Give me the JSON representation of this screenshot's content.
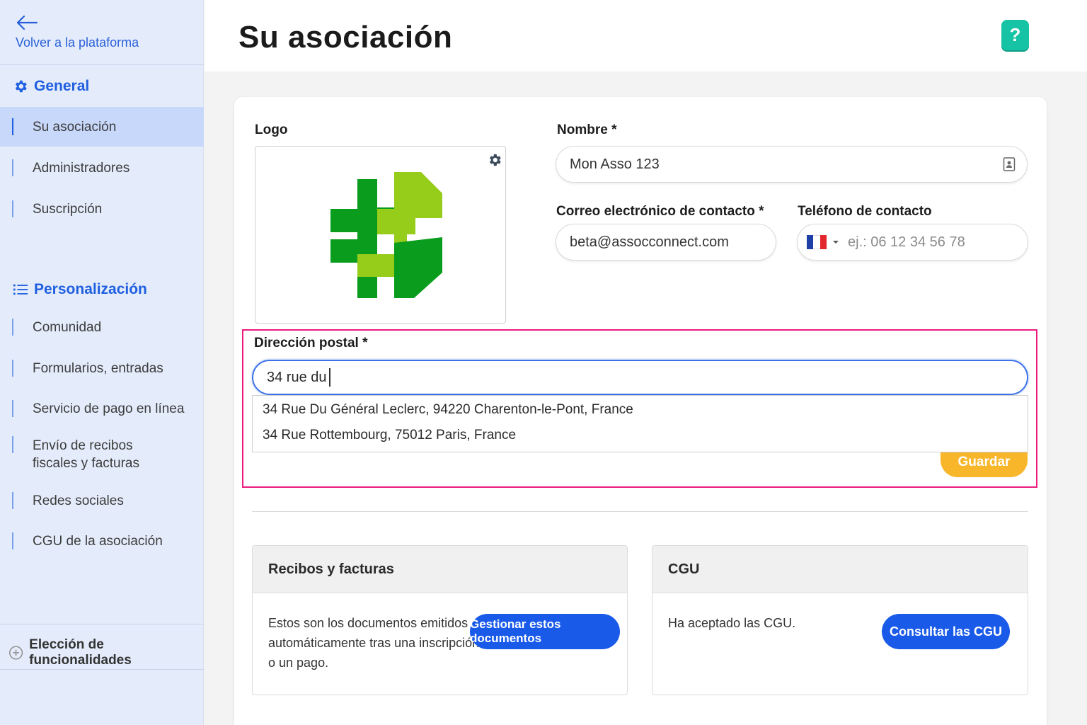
{
  "sidebar": {
    "back_label": "Volver a la plataforma",
    "sections": [
      {
        "title": "General",
        "icon": "gear-icon",
        "items": [
          {
            "label": "Su asociación",
            "active": true
          },
          {
            "label": "Administradores"
          },
          {
            "label": "Suscripción"
          }
        ]
      },
      {
        "title": "Personalización",
        "icon": "list-icon",
        "items": [
          {
            "label": "Comunidad"
          },
          {
            "label": "Formularios, entradas"
          },
          {
            "label": "Servicio de pago en línea"
          },
          {
            "label": "Envío de recibos fiscales y facturas"
          },
          {
            "label": "Redes sociales"
          },
          {
            "label": "CGU de la asociación"
          }
        ]
      }
    ],
    "feature_choice": "Elección de funcionalidades"
  },
  "header": {
    "title": "Su asociación",
    "help_label": "?"
  },
  "form": {
    "logo_label": "Logo",
    "name_label": "Nombre *",
    "name_value": "Mon Asso 123",
    "email_label": "Correo electrónico de contacto *",
    "email_value": "beta@assocconnect.com",
    "phone_label": "Teléfono de contacto",
    "phone_placeholder": "ej.: 06 12 34 56 78",
    "address_label": "Dirección postal *",
    "address_value": "34 rue du",
    "suggestions": [
      "34 Rue Du Général Leclerc, 94220 Charenton-le-Pont, France",
      "34 Rue Rottembourg, 75012 Paris, France"
    ],
    "save_label": "Guardar"
  },
  "panels": {
    "receipts": {
      "title": "Recibos y facturas",
      "text_lines": [
        "Estos son los documentos emitidos",
        "automáticamente tras una inscripción",
        "o un pago."
      ],
      "button": "Gestionar estos documentos"
    },
    "cgu": {
      "title": "CGU",
      "text": "Ha aceptado las CGU.",
      "button": "Consultar las CGU"
    }
  },
  "colors": {
    "accent": "#1f5fe0",
    "save": "#f8b62a",
    "help": "#17c3a5",
    "highlight": "#ec1b7d",
    "button": "#1a5ae8"
  }
}
